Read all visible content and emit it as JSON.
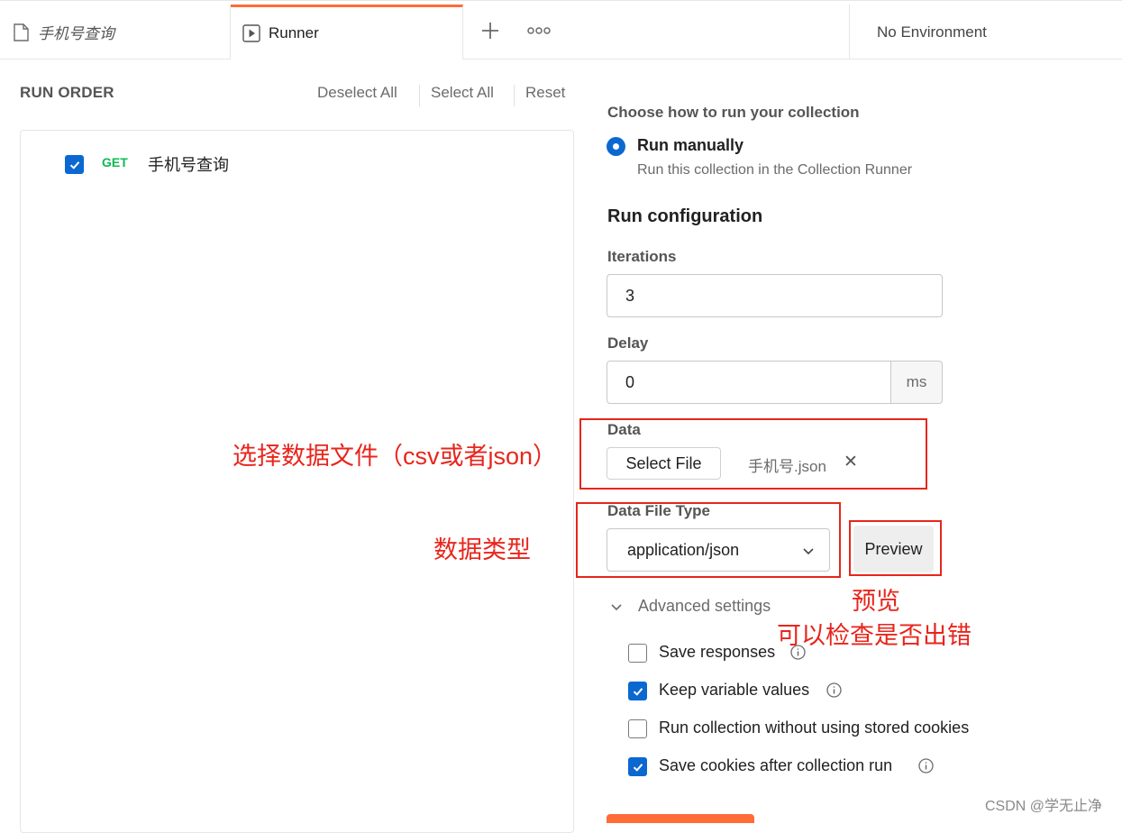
{
  "tabs": [
    {
      "label": "手机号查询",
      "icon": "document-icon"
    },
    {
      "label": "Runner",
      "icon": "play-icon"
    }
  ],
  "environment": {
    "label": "No Environment"
  },
  "left": {
    "title": "RUN ORDER",
    "deselect_all": "Deselect All",
    "select_all": "Select All",
    "reset": "Reset",
    "requests": [
      {
        "method": "GET",
        "name": "手机号查询",
        "checked": true
      }
    ]
  },
  "right": {
    "choose_heading": "Choose how to run your collection",
    "run_manually": "Run manually",
    "run_manually_desc": "Run this collection in the Collection Runner",
    "config_heading": "Run configuration",
    "iterations_label": "Iterations",
    "iterations_value": "3",
    "delay_label": "Delay",
    "delay_value": "0",
    "delay_unit": "ms",
    "data_label": "Data",
    "select_file": "Select File",
    "file_name": "手机号.json",
    "data_file_type_label": "Data File Type",
    "data_file_type_value": "application/json",
    "preview": "Preview",
    "advanced_settings": "Advanced settings",
    "options": [
      {
        "label": "Save responses",
        "checked": false,
        "info": true
      },
      {
        "label": "Keep variable values",
        "checked": true,
        "info": true
      },
      {
        "label": "Run collection without using stored cookies",
        "checked": false,
        "info": false
      },
      {
        "label": "Save cookies after collection run",
        "checked": true,
        "info": true
      }
    ]
  },
  "annotations": {
    "select_data_file": "选择数据文件（csv或者json）",
    "data_type": "数据类型",
    "preview": "预览",
    "check_errors": "可以检查是否出错"
  },
  "watermark": "CSDN @学无止净",
  "colors": {
    "accent_orange": "#ff6c37",
    "checkbox_blue": "#0b68d1",
    "get_green": "#0cbb52",
    "annotation_red": "#e8251c"
  }
}
